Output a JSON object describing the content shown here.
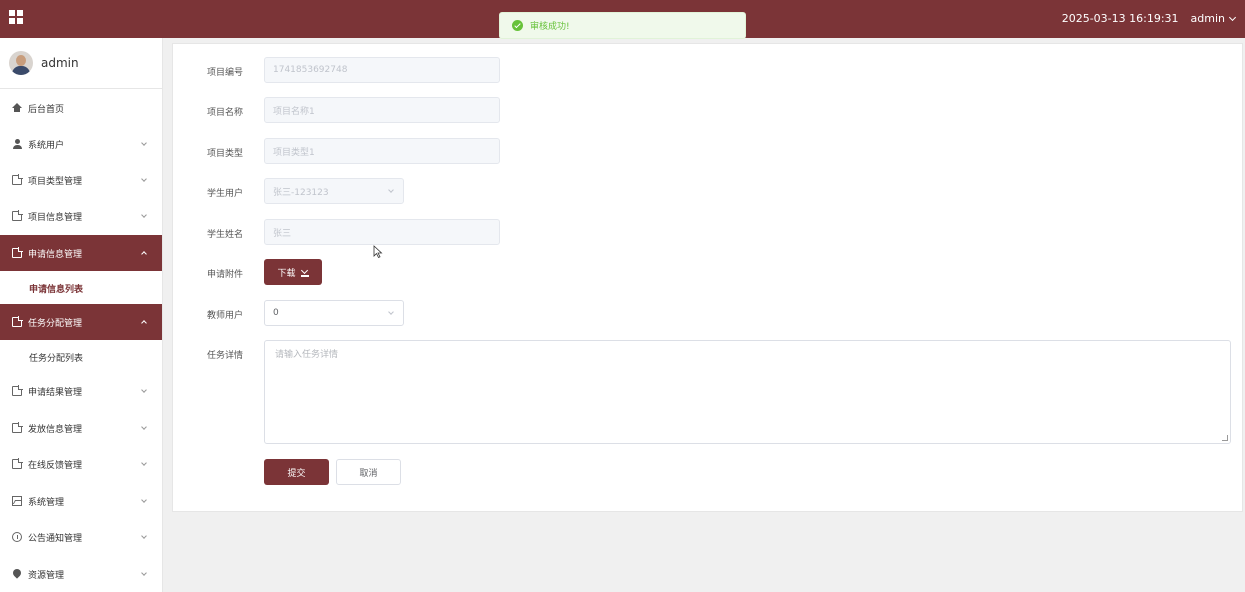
{
  "topbar": {
    "menu_icon": "grid-icon",
    "datetime": "2025-03-13 16:19:31",
    "user": "admin"
  },
  "toast": {
    "message": "审核成功!",
    "icon": "success-check-icon",
    "color": "#67c23a"
  },
  "sidebar": {
    "profile_name": "admin",
    "items": [
      {
        "label": "后台首页",
        "icon": "home-icon"
      },
      {
        "label": "系统用户",
        "icon": "user-icon"
      },
      {
        "label": "项目类型管理",
        "icon": "document-icon"
      },
      {
        "label": "项目信息管理",
        "icon": "document-icon"
      },
      {
        "label": "申请信息管理",
        "icon": "document-icon"
      },
      {
        "label": "申请信息列表"
      },
      {
        "label": "任务分配管理",
        "icon": "document-icon"
      },
      {
        "label": "任务分配列表"
      },
      {
        "label": "申请结果管理",
        "icon": "document-icon"
      },
      {
        "label": "发放信息管理",
        "icon": "document-icon"
      },
      {
        "label": "在线反馈管理",
        "icon": "document-icon"
      },
      {
        "label": "系统管理",
        "icon": "image-icon"
      },
      {
        "label": "公告通知管理",
        "icon": "info-icon"
      },
      {
        "label": "资源管理",
        "icon": "pin-icon"
      }
    ]
  },
  "form": {
    "project_no": {
      "label": "项目编号",
      "value": "1741853692748"
    },
    "project_name": {
      "label": "项目名称",
      "value": "项目名称1"
    },
    "project_type": {
      "label": "项目类型",
      "value": "项目类型1"
    },
    "student_user": {
      "label": "学生用户",
      "value": "张三-123123"
    },
    "student_name": {
      "label": "学生姓名",
      "value": "张三"
    },
    "attachment": {
      "label": "申请附件",
      "button": "下载"
    },
    "teacher_user": {
      "label": "教师用户",
      "value": "0"
    },
    "task_detail": {
      "label": "任务详情",
      "placeholder": "请输入任务详情"
    },
    "submit_label": "提交",
    "cancel_label": "取消"
  },
  "colors": {
    "brand": "#7b3437"
  }
}
